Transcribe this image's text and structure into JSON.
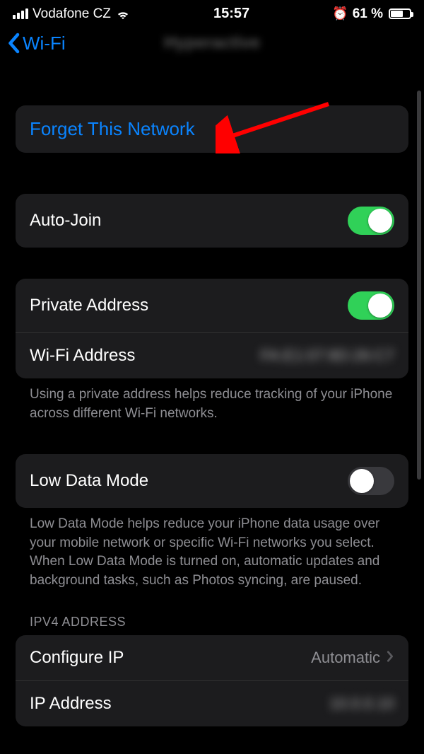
{
  "statusBar": {
    "carrier": "Vodafone CZ",
    "time": "15:57",
    "batteryText": "61 %"
  },
  "nav": {
    "back": "Wi-Fi",
    "title": "Hyperactive"
  },
  "forget": {
    "label": "Forget This Network"
  },
  "autoJoin": {
    "label": "Auto-Join",
    "on": true
  },
  "privateAddress": {
    "label": "Private Address",
    "on": true
  },
  "wifiAddress": {
    "label": "Wi-Fi Address",
    "value": "FA:E1:07:8D:26:C7"
  },
  "privateFooter": "Using a private address helps reduce tracking of your iPhone across different Wi-Fi networks.",
  "lowData": {
    "label": "Low Data Mode",
    "on": false
  },
  "lowDataFooter": "Low Data Mode helps reduce your iPhone data usage over your mobile network or specific Wi-Fi networks you select. When Low Data Mode is turned on, automatic updates and background tasks, such as Photos syncing, are paused.",
  "ipv4Header": "IPV4 ADDRESS",
  "configureIP": {
    "label": "Configure IP",
    "value": "Automatic"
  },
  "ipAddress": {
    "label": "IP Address",
    "value": "10.0.0.10"
  }
}
